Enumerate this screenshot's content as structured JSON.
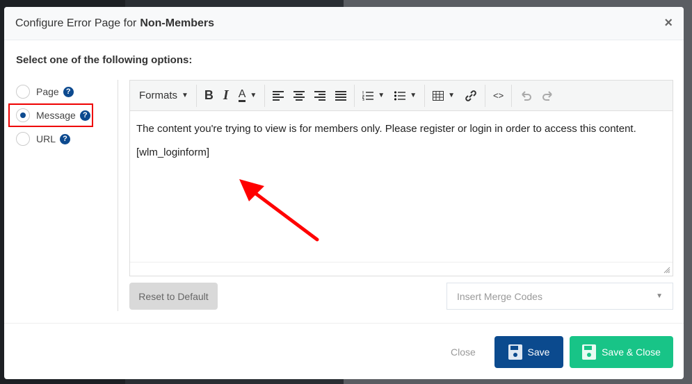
{
  "modal": {
    "title_prefix": "Configure Error Page for",
    "title_bold": "Non-Members",
    "close_icon": "×"
  },
  "prompt": "Select one of the following options:",
  "options": [
    {
      "label": "Page",
      "selected": false
    },
    {
      "label": "Message",
      "selected": true
    },
    {
      "label": "URL",
      "selected": false
    }
  ],
  "help_glyph": "?",
  "toolbar": {
    "formats": "Formats",
    "bold": "B",
    "italic": "I",
    "color": "A",
    "code": "<>"
  },
  "content": {
    "p1": "The content you're trying to view is for members only. Please register or login in order to access this content.",
    "p2": "[wlm_loginform]"
  },
  "reset_label": "Reset to Default",
  "merge_placeholder": "Insert Merge Codes",
  "footer": {
    "close": "Close",
    "save": "Save",
    "save_close": "Save & Close"
  },
  "colors": {
    "primary": "#0b4a8e",
    "success": "#18c487",
    "highlight": "#e00000"
  }
}
